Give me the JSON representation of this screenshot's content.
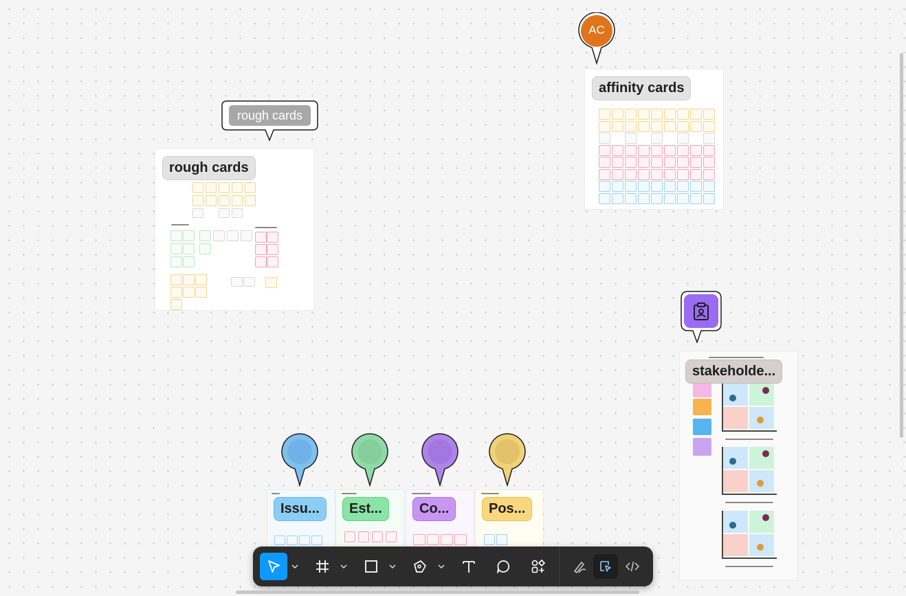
{
  "canvas": {
    "pins": {
      "rough_cards_comment": "rough cards",
      "avatar_initials": "AC"
    },
    "frames": {
      "rough_cards": "rough cards",
      "affinity_cards": "affinity cards",
      "stakeholders": "stakeholde...",
      "issues": "Issu...",
      "estimates": "Est...",
      "concerns": "Co...",
      "positives": "Pos..."
    }
  },
  "colors": {
    "avatar": "#e0741a",
    "stakeholder_pin": "#9a6cf3",
    "pin_blue": "#7fc0ef",
    "pin_green": "#8fdba6",
    "pin_purple": "#ae84e8",
    "pin_yellow": "#f1d377",
    "toolbar_active": "#0d99ff"
  },
  "toolbar": {
    "tools": [
      "move-tool",
      "frame-tool",
      "shape-tool",
      "pen-tool",
      "text-tool",
      "comment-tool",
      "actions-tool"
    ],
    "mode_tools": [
      "draw-mode",
      "design-mode",
      "dev-mode"
    ]
  }
}
